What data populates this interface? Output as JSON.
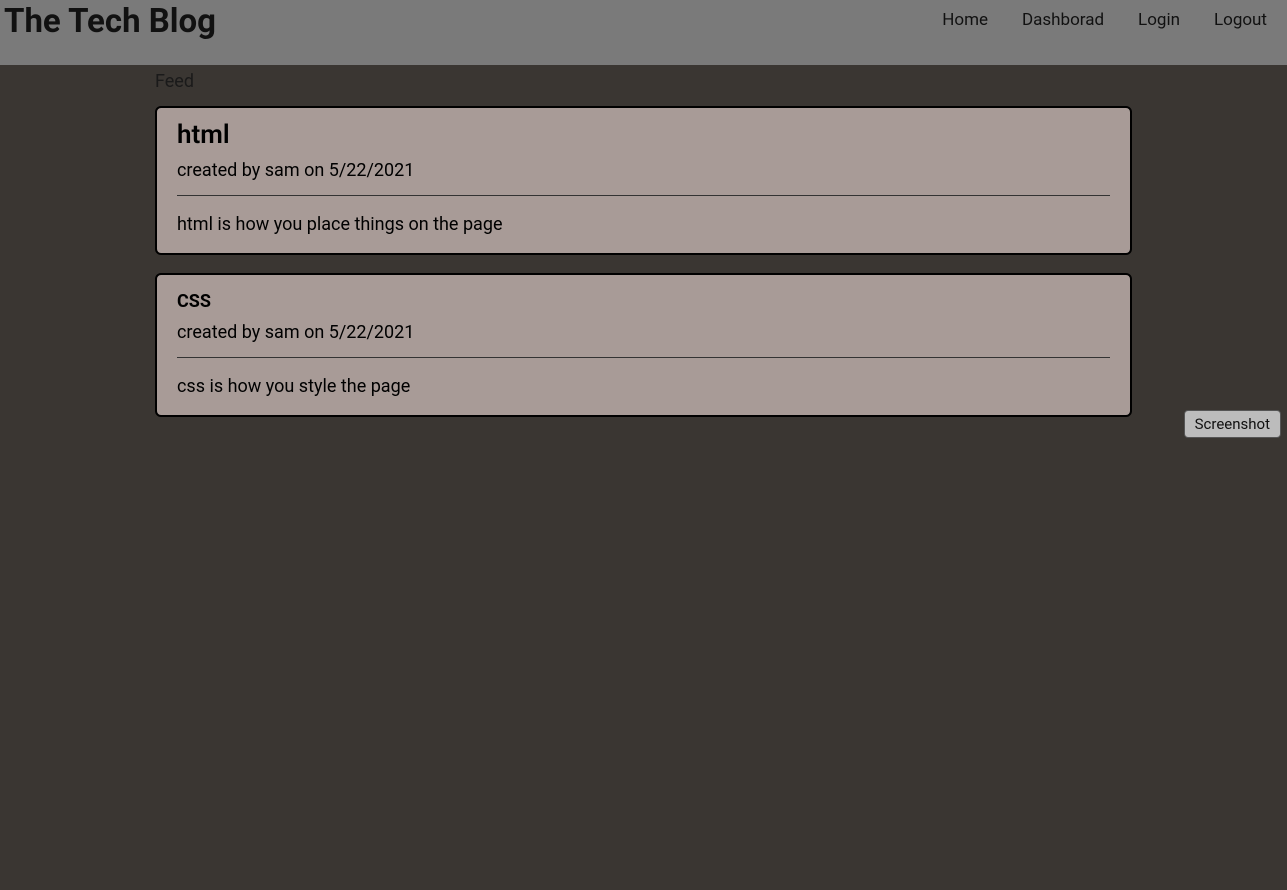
{
  "header": {
    "title": "The Tech Blog",
    "nav": {
      "home": "Home",
      "dashboard": "Dashborad",
      "login": "Login",
      "logout": "Logout"
    }
  },
  "feed": {
    "label": "Feed",
    "posts": [
      {
        "title": "html",
        "meta": "created by sam on 5/22/2021",
        "body": "html is how you place things on the page"
      },
      {
        "title": "CSS",
        "meta": "created by sam on 5/22/2021",
        "body": "css is how you style the page"
      }
    ]
  },
  "screenshot_button": "Screenshot"
}
